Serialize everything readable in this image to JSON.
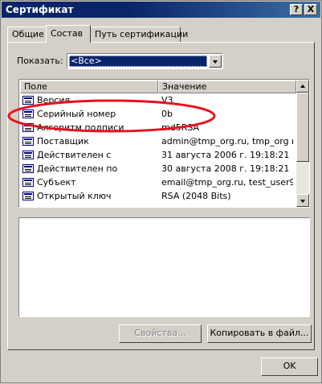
{
  "window": {
    "title": "Сертификат",
    "help_label": "?",
    "close_label": "X"
  },
  "tabs": [
    {
      "label": "Общие",
      "active": false
    },
    {
      "label": "Состав",
      "active": true
    },
    {
      "label": "Путь сертификации",
      "active": false
    }
  ],
  "show": {
    "label": "Показать:",
    "selected": "<Все>"
  },
  "list": {
    "columns": [
      "Поле",
      "Значение"
    ],
    "rows": [
      {
        "field": "Версия",
        "value": "V3"
      },
      {
        "field": "Серийный номер",
        "value": "0b"
      },
      {
        "field": "Алгоритм подписи",
        "value": "md5RSA"
      },
      {
        "field": "Поставщик",
        "value": "admin@tmp_org.ru, tmp_org r..."
      },
      {
        "field": "Действителен с",
        "value": "31 августа 2006 г. 19:18:21"
      },
      {
        "field": "Действителен по",
        "value": "30 августа 2008 г. 19:18:21"
      },
      {
        "field": "Субъект",
        "value": "email@tmp_org.ru, test_user9..."
      },
      {
        "field": "Открытый ключ",
        "value": "RSA (2048 Bits)"
      }
    ]
  },
  "buttons": {
    "properties": "Свойства...",
    "copy_to_file": "Копировать в файл...",
    "ok": "OK"
  },
  "annotation_color": "#e8101c"
}
